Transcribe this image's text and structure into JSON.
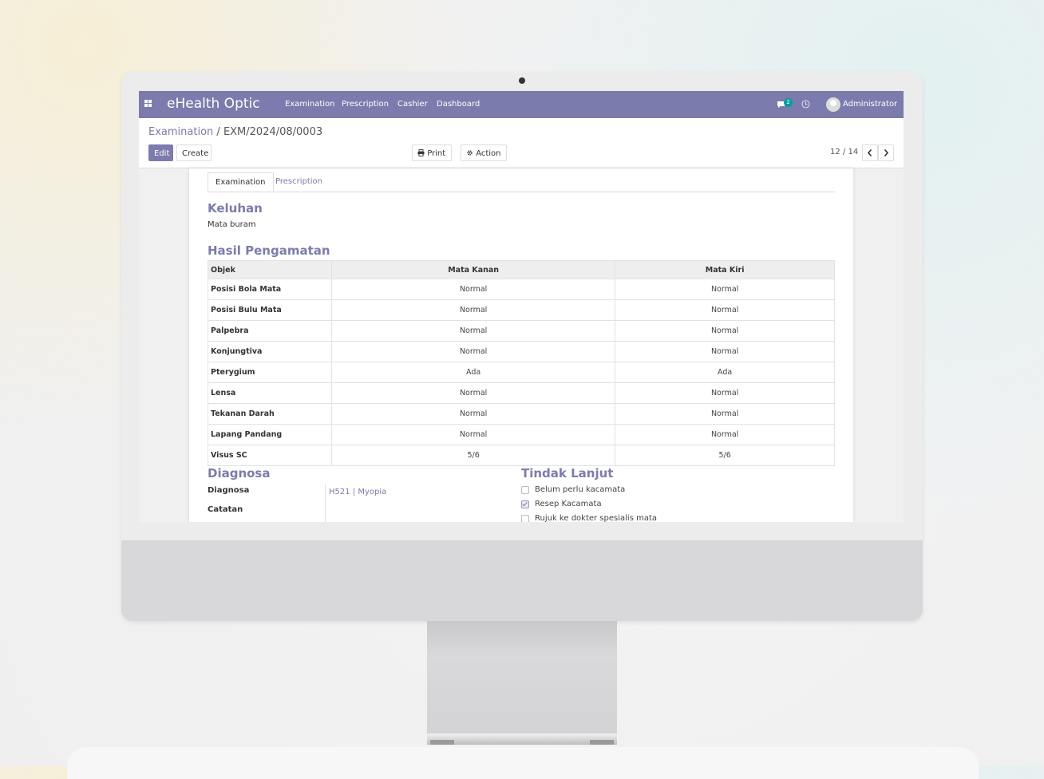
{
  "app": {
    "brand": "eHealth Optic"
  },
  "navbar": {
    "menu": [
      "Examination",
      "Prescription",
      "Cashier",
      "Dashboard"
    ],
    "messages_count": "2",
    "user": "Administrator"
  },
  "breadcrumb": {
    "parent": "Examination",
    "separator": "/",
    "current": "EXM/2024/08/0003"
  },
  "buttons": {
    "edit": "Edit",
    "create": "Create",
    "print": "Print",
    "action": "Action"
  },
  "pager": {
    "value": "12 / 14"
  },
  "tabs": [
    "Examination",
    "Prescription"
  ],
  "keluhan": {
    "title": "Keluhan",
    "text": "Mata buram"
  },
  "hasil": {
    "title": "Hasil Pengamatan",
    "columns": [
      "Objek",
      "Mata Kanan",
      "Mata Kiri"
    ],
    "rows": [
      [
        "Posisi Bola Mata",
        "Normal",
        "Normal"
      ],
      [
        "Posisi Bulu Mata",
        "Normal",
        "Normal"
      ],
      [
        "Palpebra",
        "Normal",
        "Normal"
      ],
      [
        "Konjungtiva",
        "Normal",
        "Normal"
      ],
      [
        "Pterygium",
        "Ada",
        "Ada"
      ],
      [
        "Lensa",
        "Normal",
        "Normal"
      ],
      [
        "Tekanan Darah",
        "Normal",
        "Normal"
      ],
      [
        "Lapang Pandang",
        "Normal",
        "Normal"
      ],
      [
        "Visus SC",
        "5/6",
        "5/6"
      ]
    ]
  },
  "diagnosa": {
    "title": "Diagnosa",
    "label_diagnosa": "Diagnosa",
    "value_diagnosa": "H521 | Myopia",
    "label_catatan": "Catatan"
  },
  "tindak_lanjut": {
    "title": "Tindak Lanjut",
    "options": [
      {
        "label": "Belum perlu kacamata",
        "checked": false
      },
      {
        "label": "Resep Kacamata",
        "checked": true
      },
      {
        "label": "Rujuk ke dokter spesialis mata",
        "checked": false
      }
    ]
  },
  "colors": {
    "accent": "#7c7bad",
    "badge": "#00a09d"
  }
}
